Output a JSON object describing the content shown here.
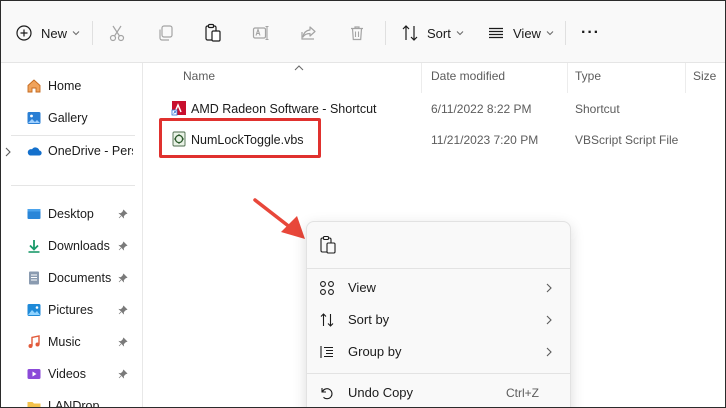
{
  "toolbar": {
    "new_label": "New",
    "sort_label": "Sort",
    "view_label": "View",
    "more_label": "···"
  },
  "sidebar": {
    "items": [
      {
        "label": "Home",
        "icon": "home-icon"
      },
      {
        "label": "Gallery",
        "icon": "gallery-icon"
      },
      {
        "label": "OneDrive - Personal",
        "icon": "onedrive-icon"
      },
      {
        "label": "Desktop",
        "icon": "desktop-icon"
      },
      {
        "label": "Downloads",
        "icon": "downloads-icon"
      },
      {
        "label": "Documents",
        "icon": "documents-icon"
      },
      {
        "label": "Pictures",
        "icon": "pictures-icon"
      },
      {
        "label": "Music",
        "icon": "music-icon"
      },
      {
        "label": "Videos",
        "icon": "videos-icon"
      },
      {
        "label": "LANDrop",
        "icon": "folder-icon"
      }
    ]
  },
  "columns": {
    "name": "Name",
    "date": "Date modified",
    "type": "Type",
    "size": "Size"
  },
  "files": [
    {
      "name": "AMD Radeon Software - Shortcut",
      "date": "6/11/2022 8:22 PM",
      "type": "Shortcut"
    },
    {
      "name": "NumLockToggle.vbs",
      "date": "11/21/2023 7:20 PM",
      "type": "VBScript Script File"
    }
  ],
  "context_menu": {
    "items": [
      {
        "label": "View",
        "icon": "view-grid-icon"
      },
      {
        "label": "Sort by",
        "icon": "sort-icon"
      },
      {
        "label": "Group by",
        "icon": "group-icon"
      },
      {
        "label": "Undo Copy",
        "icon": "undo-icon",
        "accelerator": "Ctrl+Z"
      }
    ]
  },
  "colors": {
    "accent": "#0067c0",
    "highlight": "#e0312e",
    "arrow": "#e8473a"
  }
}
